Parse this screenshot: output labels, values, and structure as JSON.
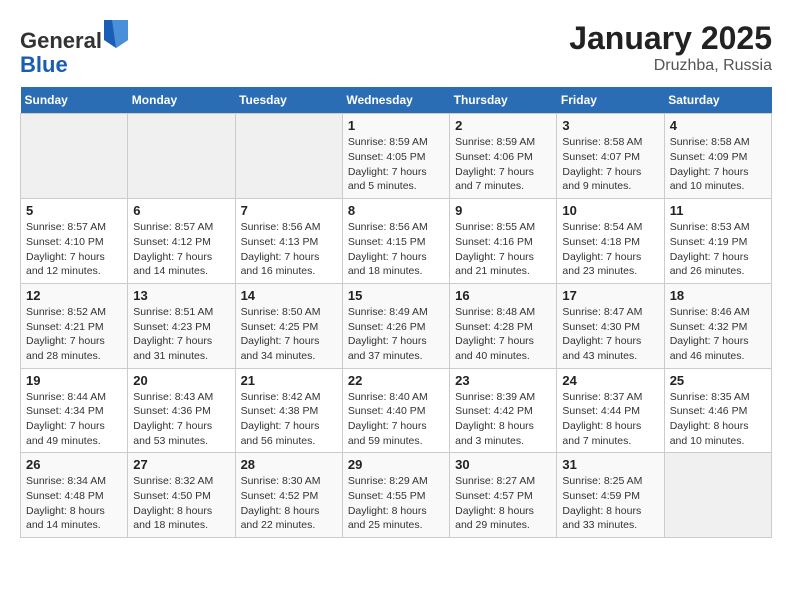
{
  "logo": {
    "general": "General",
    "blue": "Blue"
  },
  "title": "January 2025",
  "subtitle": "Druzhba, Russia",
  "days_of_week": [
    "Sunday",
    "Monday",
    "Tuesday",
    "Wednesday",
    "Thursday",
    "Friday",
    "Saturday"
  ],
  "weeks": [
    [
      {
        "num": "",
        "info": ""
      },
      {
        "num": "",
        "info": ""
      },
      {
        "num": "",
        "info": ""
      },
      {
        "num": "1",
        "info": "Sunrise: 8:59 AM\nSunset: 4:05 PM\nDaylight: 7 hours\nand 5 minutes."
      },
      {
        "num": "2",
        "info": "Sunrise: 8:59 AM\nSunset: 4:06 PM\nDaylight: 7 hours\nand 7 minutes."
      },
      {
        "num": "3",
        "info": "Sunrise: 8:58 AM\nSunset: 4:07 PM\nDaylight: 7 hours\nand 9 minutes."
      },
      {
        "num": "4",
        "info": "Sunrise: 8:58 AM\nSunset: 4:09 PM\nDaylight: 7 hours\nand 10 minutes."
      }
    ],
    [
      {
        "num": "5",
        "info": "Sunrise: 8:57 AM\nSunset: 4:10 PM\nDaylight: 7 hours\nand 12 minutes."
      },
      {
        "num": "6",
        "info": "Sunrise: 8:57 AM\nSunset: 4:12 PM\nDaylight: 7 hours\nand 14 minutes."
      },
      {
        "num": "7",
        "info": "Sunrise: 8:56 AM\nSunset: 4:13 PM\nDaylight: 7 hours\nand 16 minutes."
      },
      {
        "num": "8",
        "info": "Sunrise: 8:56 AM\nSunset: 4:15 PM\nDaylight: 7 hours\nand 18 minutes."
      },
      {
        "num": "9",
        "info": "Sunrise: 8:55 AM\nSunset: 4:16 PM\nDaylight: 7 hours\nand 21 minutes."
      },
      {
        "num": "10",
        "info": "Sunrise: 8:54 AM\nSunset: 4:18 PM\nDaylight: 7 hours\nand 23 minutes."
      },
      {
        "num": "11",
        "info": "Sunrise: 8:53 AM\nSunset: 4:19 PM\nDaylight: 7 hours\nand 26 minutes."
      }
    ],
    [
      {
        "num": "12",
        "info": "Sunrise: 8:52 AM\nSunset: 4:21 PM\nDaylight: 7 hours\nand 28 minutes."
      },
      {
        "num": "13",
        "info": "Sunrise: 8:51 AM\nSunset: 4:23 PM\nDaylight: 7 hours\nand 31 minutes."
      },
      {
        "num": "14",
        "info": "Sunrise: 8:50 AM\nSunset: 4:25 PM\nDaylight: 7 hours\nand 34 minutes."
      },
      {
        "num": "15",
        "info": "Sunrise: 8:49 AM\nSunset: 4:26 PM\nDaylight: 7 hours\nand 37 minutes."
      },
      {
        "num": "16",
        "info": "Sunrise: 8:48 AM\nSunset: 4:28 PM\nDaylight: 7 hours\nand 40 minutes."
      },
      {
        "num": "17",
        "info": "Sunrise: 8:47 AM\nSunset: 4:30 PM\nDaylight: 7 hours\nand 43 minutes."
      },
      {
        "num": "18",
        "info": "Sunrise: 8:46 AM\nSunset: 4:32 PM\nDaylight: 7 hours\nand 46 minutes."
      }
    ],
    [
      {
        "num": "19",
        "info": "Sunrise: 8:44 AM\nSunset: 4:34 PM\nDaylight: 7 hours\nand 49 minutes."
      },
      {
        "num": "20",
        "info": "Sunrise: 8:43 AM\nSunset: 4:36 PM\nDaylight: 7 hours\nand 53 minutes."
      },
      {
        "num": "21",
        "info": "Sunrise: 8:42 AM\nSunset: 4:38 PM\nDaylight: 7 hours\nand 56 minutes."
      },
      {
        "num": "22",
        "info": "Sunrise: 8:40 AM\nSunset: 4:40 PM\nDaylight: 7 hours\nand 59 minutes."
      },
      {
        "num": "23",
        "info": "Sunrise: 8:39 AM\nSunset: 4:42 PM\nDaylight: 8 hours\nand 3 minutes."
      },
      {
        "num": "24",
        "info": "Sunrise: 8:37 AM\nSunset: 4:44 PM\nDaylight: 8 hours\nand 7 minutes."
      },
      {
        "num": "25",
        "info": "Sunrise: 8:35 AM\nSunset: 4:46 PM\nDaylight: 8 hours\nand 10 minutes."
      }
    ],
    [
      {
        "num": "26",
        "info": "Sunrise: 8:34 AM\nSunset: 4:48 PM\nDaylight: 8 hours\nand 14 minutes."
      },
      {
        "num": "27",
        "info": "Sunrise: 8:32 AM\nSunset: 4:50 PM\nDaylight: 8 hours\nand 18 minutes."
      },
      {
        "num": "28",
        "info": "Sunrise: 8:30 AM\nSunset: 4:52 PM\nDaylight: 8 hours\nand 22 minutes."
      },
      {
        "num": "29",
        "info": "Sunrise: 8:29 AM\nSunset: 4:55 PM\nDaylight: 8 hours\nand 25 minutes."
      },
      {
        "num": "30",
        "info": "Sunrise: 8:27 AM\nSunset: 4:57 PM\nDaylight: 8 hours\nand 29 minutes."
      },
      {
        "num": "31",
        "info": "Sunrise: 8:25 AM\nSunset: 4:59 PM\nDaylight: 8 hours\nand 33 minutes."
      },
      {
        "num": "",
        "info": ""
      }
    ]
  ]
}
